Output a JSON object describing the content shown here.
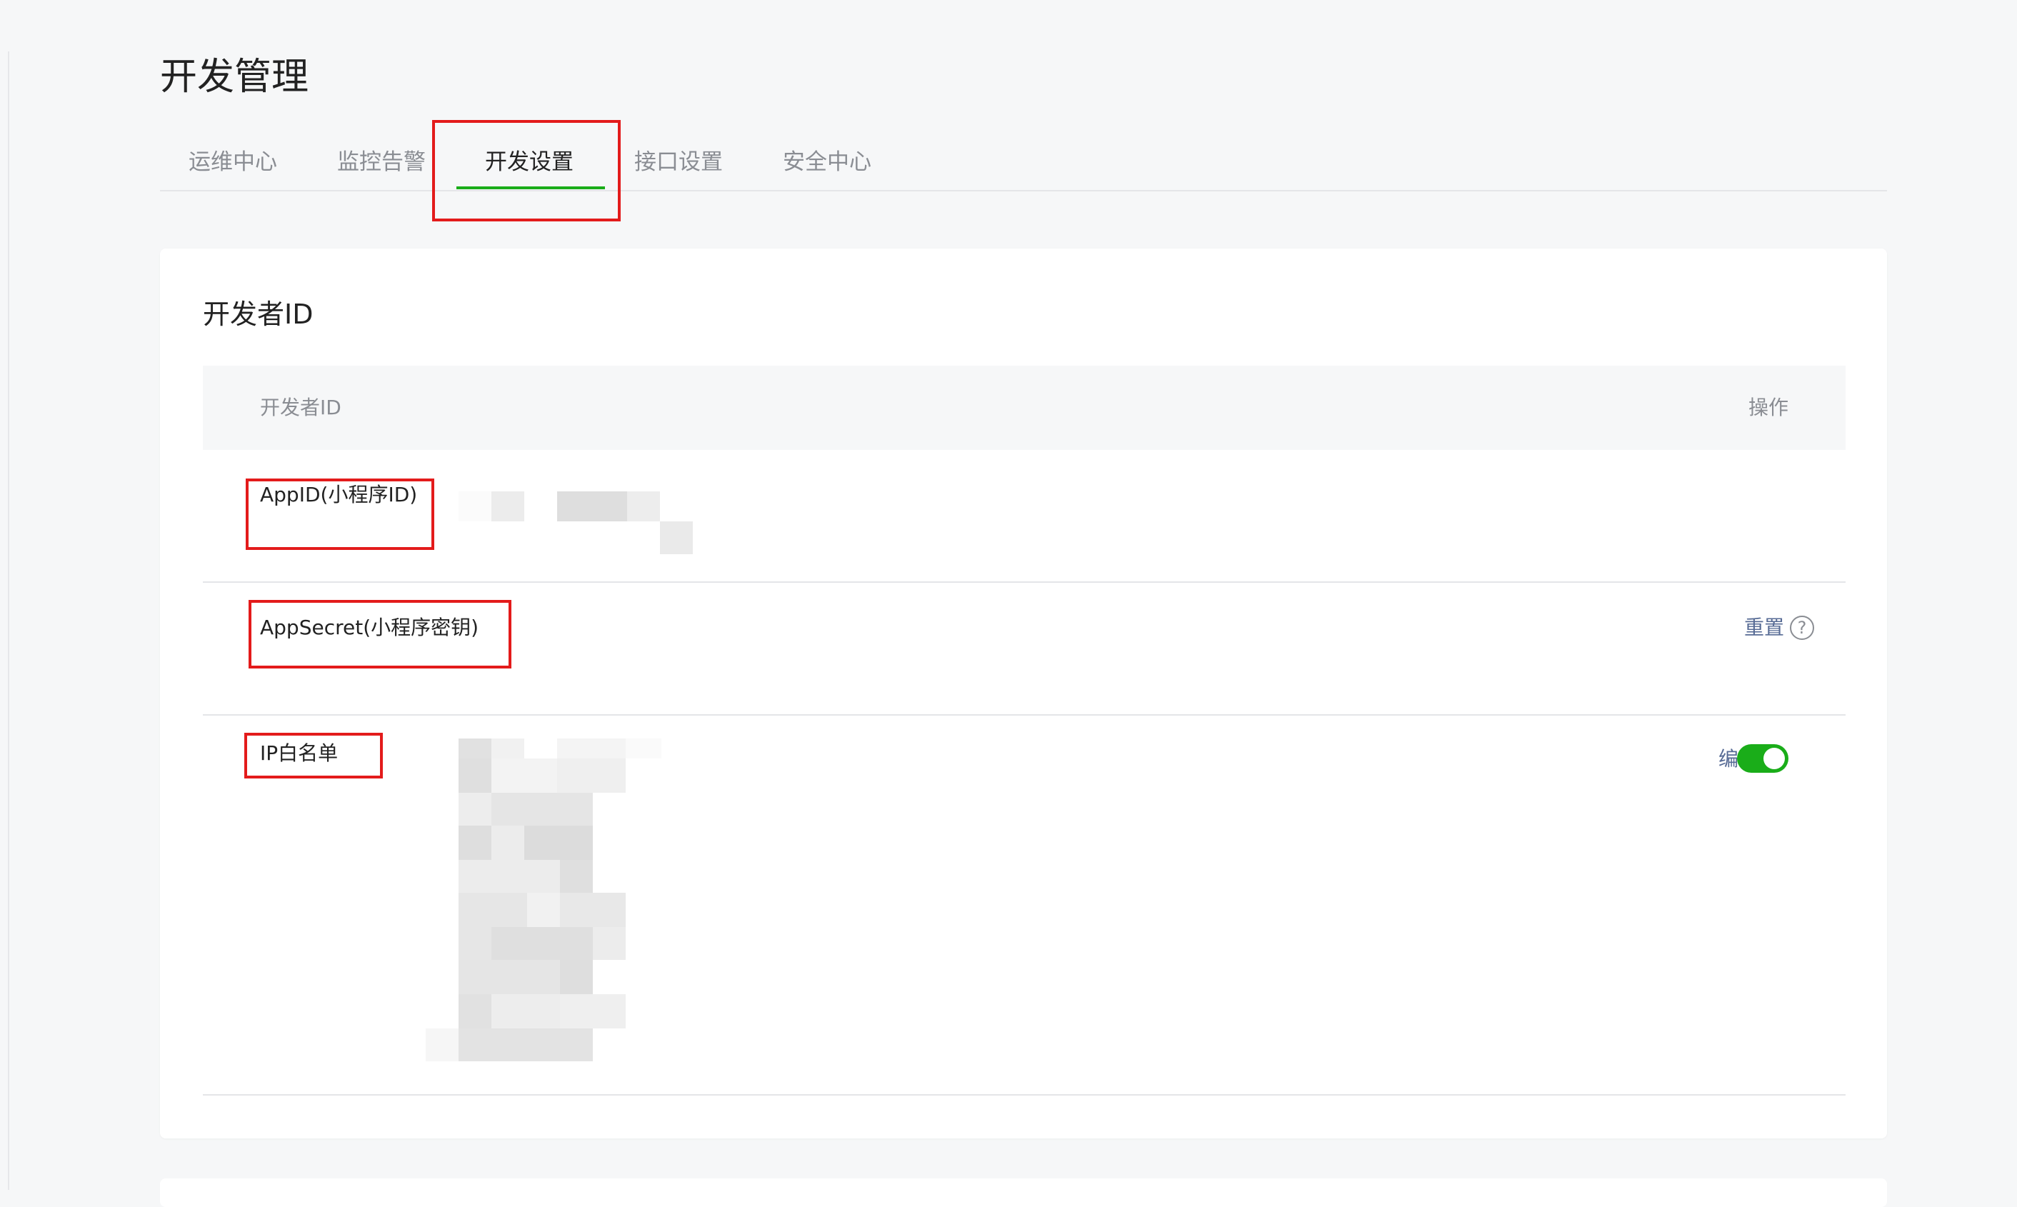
{
  "page": {
    "title": "开发管理"
  },
  "tabs": [
    {
      "label": "运维中心",
      "active": false
    },
    {
      "label": "监控告警",
      "active": false
    },
    {
      "label": "开发设置",
      "active": true
    },
    {
      "label": "接口设置",
      "active": false
    },
    {
      "label": "安全中心",
      "active": false
    }
  ],
  "section": {
    "title": "开发者ID",
    "table": {
      "header_left": "开发者ID",
      "header_right": "操作",
      "rows": [
        {
          "label": "AppID(小程序ID)",
          "value": "",
          "action": ""
        },
        {
          "label": "AppSecret(小程序密钥)",
          "value": "",
          "action": "重置",
          "help_icon": "?"
        },
        {
          "label": "IP白名单",
          "value": "",
          "action": "编辑",
          "toggle_on": true
        }
      ]
    }
  },
  "colors": {
    "accent_green": "#1aad19",
    "link_blue": "#576b95",
    "highlight_red": "#e31b1b",
    "background": "#f6f7f8"
  },
  "icons": {
    "help": "question-circle-icon",
    "toggle": "toggle-switch-icon"
  }
}
